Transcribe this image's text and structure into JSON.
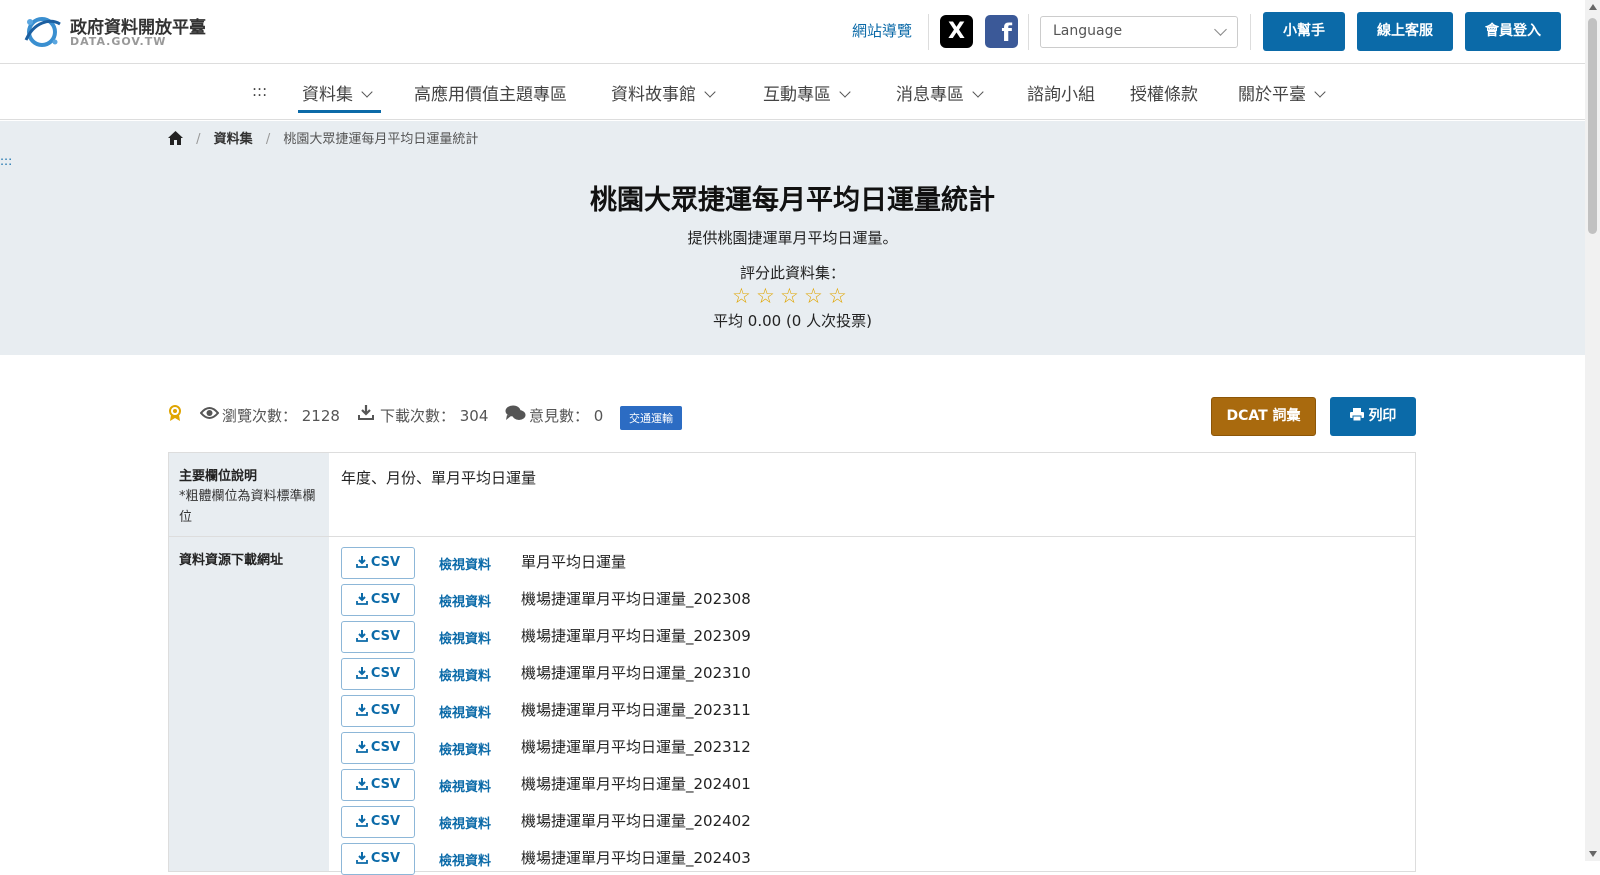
{
  "header": {
    "logo_title": "政府資料開放平臺",
    "logo_sub": "DATA.GOV.TW",
    "sitemap": "網站導覽",
    "x_icon": "X",
    "fb_icon": "f",
    "language_placeholder": "Language",
    "buttons": [
      "小幫手",
      "線上客服",
      "會員登入"
    ]
  },
  "nav": {
    "skip": ":::",
    "items": [
      {
        "label": "資料集",
        "dropdown": true,
        "active": true
      },
      {
        "label": "高應用價值主題專區",
        "dropdown": false
      },
      {
        "label": "資料故事館",
        "dropdown": true
      },
      {
        "label": "互動專區",
        "dropdown": true
      },
      {
        "label": "消息專區",
        "dropdown": true
      },
      {
        "label": "諮詢小組",
        "dropdown": false
      },
      {
        "label": "授權條款",
        "dropdown": false
      },
      {
        "label": "關於平臺",
        "dropdown": true
      }
    ]
  },
  "breadcrumb": {
    "items": [
      "資料集",
      "桃園大眾捷運每月平均日運量統計"
    ]
  },
  "side_marker": ":::",
  "dataset": {
    "title": "桃園大眾捷運每月平均日運量統計",
    "description": "提供桃園捷運單月平均日運量。",
    "rate_label": "評分此資料集：",
    "stars": [
      "☆",
      "☆",
      "☆",
      "☆",
      "☆"
    ],
    "rating_value": 0,
    "average": "平均 0.00 (0 人次投票)"
  },
  "stats": {
    "views": "瀏覽次數： 2128",
    "downloads": "下載次數： 304",
    "comments": "意見數： 0",
    "tag": "交通運輸",
    "dcat_button": "DCAT 詞彙",
    "print_button": "列印"
  },
  "table": {
    "fields_label": "主要欄位說明",
    "fields_note": "*粗體欄位為資料標準欄位",
    "fields_value": "年度、月份、單月平均日運量",
    "resources_label": "資料資源下載網址",
    "csv_label": "CSV",
    "view_label": "檢視資料",
    "resources": [
      "單月平均日運量",
      "機場捷運單月平均日運量_202308",
      "機場捷運單月平均日運量_202309",
      "機場捷運單月平均日運量_202310",
      "機場捷運單月平均日運量_202311",
      "機場捷運單月平均日運量_202312",
      "機場捷運單月平均日運量_202401",
      "機場捷運單月平均日運量_202402",
      "機場捷運單月平均日運量_202403"
    ]
  },
  "colors": {
    "primary": "#0b6aa8",
    "hero_bg": "#e8edf1",
    "dcat": "#a96a0e",
    "tag": "#2c6cc3",
    "star": "#e0a500"
  }
}
